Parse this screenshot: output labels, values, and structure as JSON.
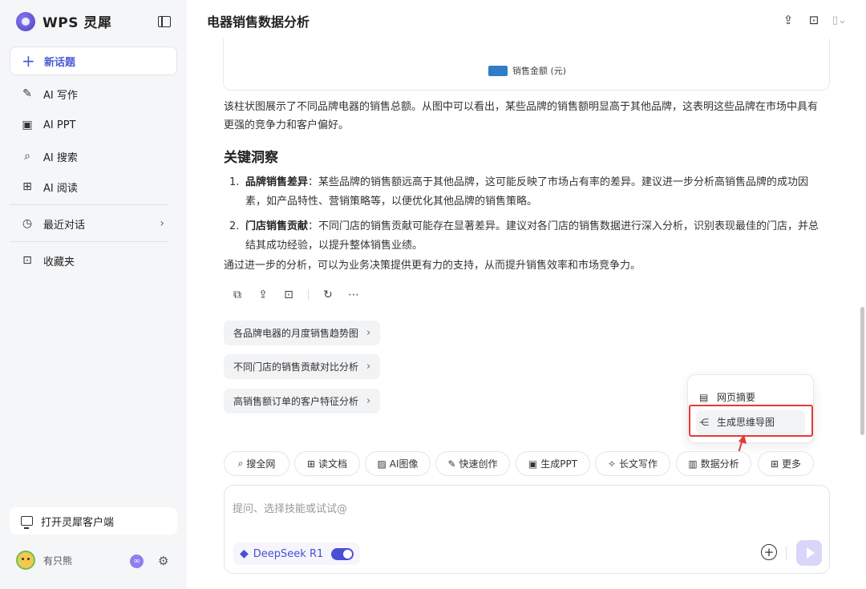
{
  "sidebar": {
    "brand": "WPS 灵犀",
    "new_topic": "新话题",
    "items": [
      {
        "label": "AI 写作",
        "icon": "pen-icon"
      },
      {
        "label": "AI PPT",
        "icon": "ppt-icon"
      },
      {
        "label": "AI 搜索",
        "icon": "search-icon"
      },
      {
        "label": "AI 阅读",
        "icon": "book-icon"
      }
    ],
    "recent": "最近对话",
    "favorites": "收藏夹",
    "open_client": "打开灵犀客户端",
    "user_name": "有只熊"
  },
  "header": {
    "title": "电器销售数据分析"
  },
  "chart": {
    "legend": "销售金额 (元)",
    "legend_color": "#2f7dc7"
  },
  "content": {
    "summary": "该柱状图展示了不同品牌电器的销售总额。从图中可以看出，某些品牌的销售额明显高于其他品牌，这表明这些品牌在市场中具有更强的竞争力和客户偏好。",
    "insight_heading": "关键洞察",
    "insights": [
      {
        "num": "1.",
        "title": "品牌销售差异",
        "text": "：某些品牌的销售额远高于其他品牌，这可能反映了市场占有率的差异。建议进一步分析高销售品牌的成功因素，如产品特性、营销策略等，以便优化其他品牌的销售策略。"
      },
      {
        "num": "2.",
        "title": "门店销售贡献",
        "text": "：不同门店的销售贡献可能存在显著差异。建议对各门店的销售数据进行深入分析，识别表现最佳的门店，并总结其成功经验，以提升整体销售业绩。"
      }
    ],
    "conclusion": "通过进一步的分析，可以为业务决策提供更有力的支持，从而提升销售效率和市场竞争力。"
  },
  "suggestions": [
    "各品牌电器的月度销售趋势图",
    "不同门店的销售贡献对比分析",
    "高销售额订单的客户特征分析"
  ],
  "popup": {
    "items": [
      "网页摘要",
      "生成思维导图"
    ],
    "highlight_color": "#e53935"
  },
  "tools": [
    {
      "label": "搜全网",
      "icon": "search-icon"
    },
    {
      "label": "读文档",
      "icon": "book-icon"
    },
    {
      "label": "AI图像",
      "icon": "image-icon"
    },
    {
      "label": "快速创作",
      "icon": "pen-icon"
    },
    {
      "label": "生成PPT",
      "icon": "ppt-icon"
    },
    {
      "label": "长文写作",
      "icon": "sparkle-icon"
    },
    {
      "label": "数据分析",
      "icon": "chart-icon"
    },
    {
      "label": "更多",
      "icon": "grid-icon"
    }
  ],
  "input": {
    "placeholder": "提问、选择技能或试试@",
    "model": "DeepSeek R1",
    "accent": "#4a4fd6"
  }
}
